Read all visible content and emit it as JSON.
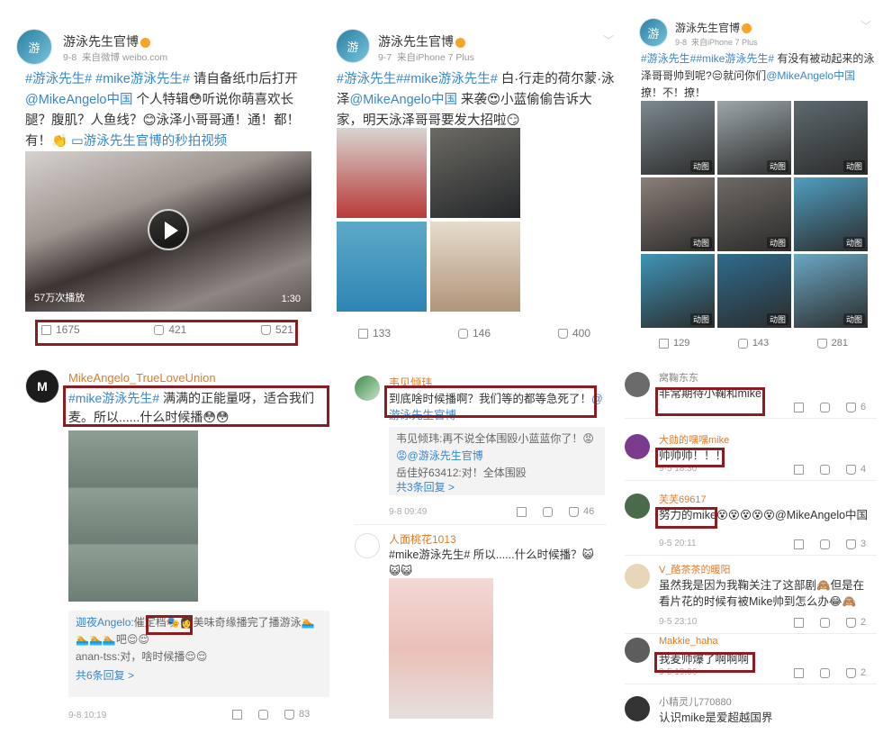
{
  "post1": {
    "username": "游泳先生官博",
    "date": "9-8",
    "source": "来自微博 weibo.com",
    "text_parts": [
      "#游泳先生# #mike游泳先生#",
      " 请自备纸巾后打开",
      "@MikeAngelo中国",
      " 个人特辑😳听说你萌喜欢长腿？腹肌？人鱼线？😊泳泽小哥哥通！通！都！有！👏 ",
      "游泳先生官博的秒拍视频"
    ],
    "video_views": "57万次播放",
    "video_duration": "1:30",
    "shares": "1675",
    "comments": "421",
    "likes": "521"
  },
  "post2": {
    "username": "游泳先生官博",
    "date": "9-7",
    "source": "来自iPhone 7 Plus",
    "text_parts": [
      "#游泳先生##mike游泳先生#",
      " 白·行走的荷尔蒙·泳泽",
      "@MikeAngelo中国",
      " 来袭😍小蓝偷偷告诉大家，明天泳泽哥哥要发大招啦😏"
    ],
    "shares": "133",
    "comments": "146",
    "likes": "400"
  },
  "post3": {
    "username": "游泳先生官博",
    "date": "9-8",
    "source": "来自iPhone 7 Plus",
    "text_parts": [
      "#游泳先生##mike游泳先生#",
      " 有没有被动起来的泳泽哥哥帅到呢?😒就问你们",
      "@MikeAngelo中国",
      " 撩！不！撩！"
    ],
    "gif_label": "动图",
    "shares": "129",
    "comments": "143",
    "likes": "281"
  },
  "comment_left": {
    "username": "MikeAngelo_TrueLoveUnion",
    "text_tag": "#mike游泳先生#",
    "text": " 满满的正能量呀，适合我们麦。所以......什么时候播😳😳",
    "replies": [
      {
        "name": "迦夜Angelo:",
        "text": "催定档",
        "tail": "🎭👩美味奇缘播完了播游泳🏊🏊🏊🏊吧😌😌"
      },
      {
        "name": "anan-tss:",
        "text": "对，啥时候播😌😌",
        "tail": ""
      }
    ],
    "more": "共6条回复 >",
    "time": "9-8 10:19",
    "likes": "83"
  },
  "comment_mid": {
    "c1_user": "韦见倾玮",
    "c1_text": "到底啥时候播啊？我们等的都等急死了！",
    "c1_mention": "@游泳先生官博",
    "replies": [
      {
        "name": "韦见倾玮:",
        "text": "再不说全体围殴小蓝蓝你了！😡",
        "mention": ""
      },
      {
        "name": "",
        "text": "😡@游泳先生官博",
        "mention": ""
      },
      {
        "name": "岳佳好63412:",
        "text": "对！全体围殴",
        "mention": ""
      }
    ],
    "more": "共3条回复 >",
    "c1_time": "9-8 09:49",
    "c1_likes": "46",
    "c2_user": "人面桃花1013",
    "c2_text": "#mike游泳先生# 所以......什么时候播？😺😺😺"
  },
  "comment_right": [
    {
      "user": "窝鞠东东",
      "text": "非常期待小鞠和mike",
      "time": "",
      "likes": "6"
    },
    {
      "user": "大勋的嘿嘿mike",
      "text": "帅帅帅！！！",
      "time": "9-5 18:30",
      "likes": "4"
    },
    {
      "user": "芙芙69617",
      "text": "努力的mike😵😵😵😵😵@MikeAngelo中国",
      "time": "9-5 20:11",
      "likes": "3"
    },
    {
      "user": "V_酪茶茶的暖阳",
      "text": "虽然我是因为我鞠关注了这部剧🙈但是在看片花的时候有被Mike帅到怎么办😂🙈",
      "time": "9-5 23:10",
      "likes": "2"
    },
    {
      "user": "Makkie_haha",
      "text": "我麦帅爆了啊啊啊",
      "time": "9-5 19:06",
      "likes": "2"
    },
    {
      "user": "小精灵儿770880",
      "text": "认识mike是爱超越国界",
      "time": "",
      "likes": ""
    }
  ],
  "colors": {
    "accent": "#3a86c8",
    "highlight_box": "#8b1c22",
    "name_orange": "#e07b2a"
  }
}
